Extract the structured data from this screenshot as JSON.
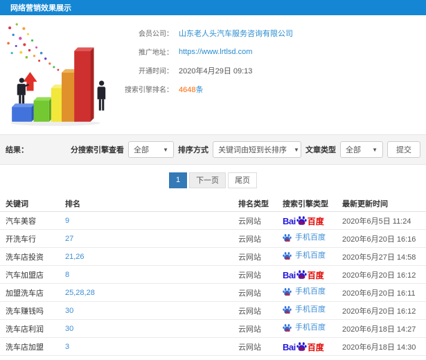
{
  "title_bar": {
    "title": "网络营销效果展示"
  },
  "info_panel": {
    "rows": [
      {
        "label": "会员公司：",
        "value": "山东老人头汽车服务咨询有限公司",
        "style": "link"
      },
      {
        "label": "推广地址：",
        "value": "https://www.lrtlsd.com",
        "style": "link"
      },
      {
        "label": "开通时间：",
        "value": "2020年4月29日 09:13",
        "style": "plain"
      },
      {
        "label": "搜索引擎排名：",
        "value": "4648",
        "suffix": "条",
        "style": "count"
      }
    ]
  },
  "filter_bar": {
    "result_label": "结果：",
    "engine_filter_label": "分搜索引擎查看",
    "engine_filter_value": "全部",
    "sort_label": "排序方式",
    "sort_value": "关键词由短到长排序",
    "article_type_label": "文章类型",
    "article_type_value": "全部",
    "submit_label": "提交"
  },
  "pagination": {
    "current_page": "1",
    "next_label": "下一页",
    "last_label": "尾页"
  },
  "table": {
    "headers": {
      "keyword": "关键词",
      "rank": "排名",
      "rank_type": "排名类型",
      "engine_type": "搜索引擎类型",
      "updated": "最新更新时间"
    },
    "rows": [
      {
        "keyword": "汽车美容",
        "rank": "9",
        "rank_type": "云网站",
        "engine": "baidu",
        "updated": "2020年6月5日 11:24"
      },
      {
        "keyword": "开洗车行",
        "rank": "27",
        "rank_type": "云网站",
        "engine": "mobile_baidu",
        "updated": "2020年6月20日 16:16"
      },
      {
        "keyword": "洗车店投资",
        "rank": "21,26",
        "rank_type": "云网站",
        "engine": "mobile_baidu",
        "updated": "2020年5月27日 14:58"
      },
      {
        "keyword": "汽车加盟店",
        "rank": "8",
        "rank_type": "云网站",
        "engine": "baidu",
        "updated": "2020年6月20日 16:12"
      },
      {
        "keyword": "加盟洗车店",
        "rank": "25,28,28",
        "rank_type": "云网站",
        "engine": "mobile_baidu",
        "updated": "2020年6月20日 16:11"
      },
      {
        "keyword": "洗车赚钱吗",
        "rank": "30",
        "rank_type": "云网站",
        "engine": "mobile_baidu",
        "updated": "2020年6月20日 16:12"
      },
      {
        "keyword": "洗车店利润",
        "rank": "30",
        "rank_type": "云网站",
        "engine": "mobile_baidu",
        "updated": "2020年6月18日 14:27"
      },
      {
        "keyword": "洗车店加盟",
        "rank": "3",
        "rank_type": "云网站",
        "engine": "baidu",
        "updated": "2020年6月18日 14:30"
      }
    ]
  },
  "engine_logos": {
    "baidu": {
      "bai": "Bai",
      "du": "du",
      "cn": "百度"
    },
    "mobile_baidu": {
      "du": "du",
      "label": "手机百度"
    }
  },
  "colors": {
    "titlebar_bg": "#1486d3",
    "link_blue": "#2a8cd0",
    "count_orange": "#ff6600",
    "pagination_active_blue": "#337ab7",
    "baidu_blue": "#2319dc",
    "baidu_red": "#e10601",
    "mobile_baidu_blue": "#3c8dd5"
  }
}
